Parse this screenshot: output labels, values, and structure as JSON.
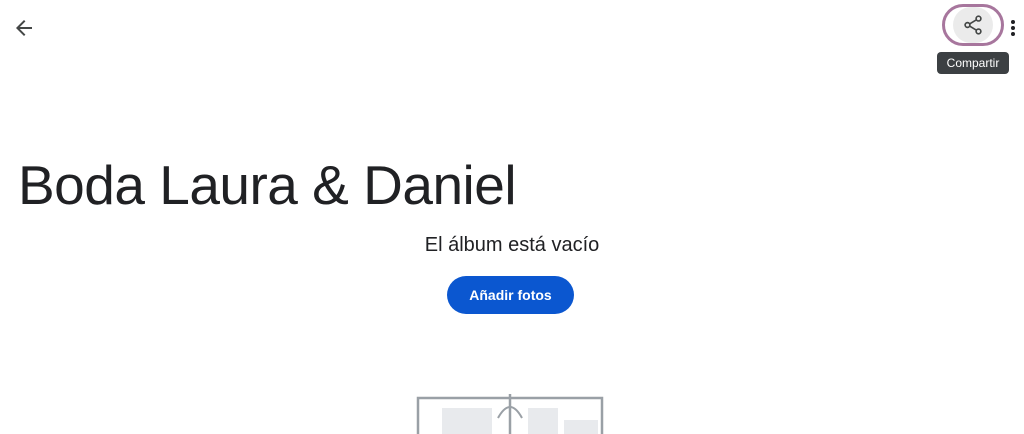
{
  "topbar": {
    "back_icon": "arrow-left-icon",
    "share_icon": "share-icon",
    "more_icon": "more-vertical-icon",
    "tooltip": "Compartir"
  },
  "album": {
    "title": "Boda Laura & Daniel",
    "empty_message": "El álbum está vacío",
    "add_photos_label": "Añadir fotos"
  },
  "colors": {
    "primary": "#0b57d0",
    "share_highlight": "#a7769d",
    "tooltip_bg": "#3c4043",
    "text": "#202124",
    "icon": "#444746"
  },
  "illustration_icon": "empty-album-illustration-icon"
}
